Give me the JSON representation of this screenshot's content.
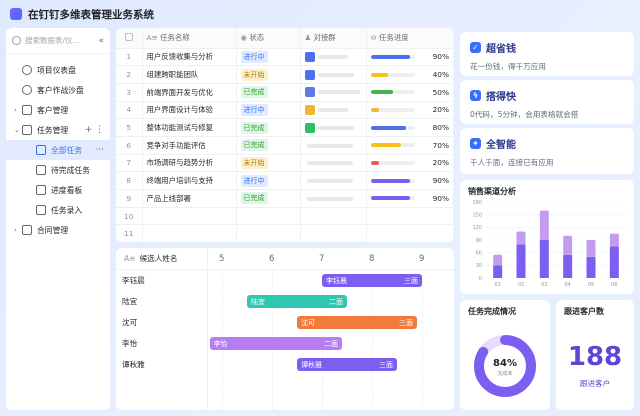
{
  "app": {
    "title": "在钉钉多维表管理业务系统"
  },
  "sidebar": {
    "search_placeholder": "搜索数据表/仪...",
    "collapse": "«",
    "items": [
      {
        "label": "项目仪表盘",
        "icon": "dashboard-icon"
      },
      {
        "label": "客户作战沙盘",
        "icon": "dashboard-icon"
      },
      {
        "label": "客户管理",
        "icon": "table-icon"
      },
      {
        "label": "任务管理",
        "icon": "table-icon"
      },
      {
        "label": "全部任务",
        "icon": "grid-icon"
      },
      {
        "label": "待完成任务",
        "icon": "list-icon"
      },
      {
        "label": "进度看板",
        "icon": "kanban-icon"
      },
      {
        "label": "任务录入",
        "icon": "form-icon"
      },
      {
        "label": "合同管理",
        "icon": "table-icon"
      }
    ]
  },
  "table": {
    "headers": {
      "name": "任务名称",
      "status": "状态",
      "group": "对接群",
      "progress": "任务进度"
    },
    "rows": [
      {
        "no": "1",
        "name": "用户反馈收集与分析",
        "status": "进行中",
        "status_type": "doing",
        "group_color": "#4e6ef2",
        "progress": 90,
        "bar_color": "#4e6ef2"
      },
      {
        "no": "2",
        "name": "组建跨职能团队",
        "status": "未开始",
        "status_type": "todo",
        "group_color": "#4e6ef2",
        "progress": 40,
        "bar_color": "#f5c318"
      },
      {
        "no": "3",
        "name": "前端界面开发与优化",
        "status": "已完成",
        "status_type": "done",
        "group_color": "#5e7ce0",
        "progress": 50,
        "bar_color": "#44b549"
      },
      {
        "no": "4",
        "name": "用户界面设计与体验",
        "status": "进行中",
        "status_type": "doing",
        "group_color": "#f2b530",
        "progress": 20,
        "bar_color": "#f2b530"
      },
      {
        "no": "5",
        "name": "整体功能测试与修复",
        "status": "已完成",
        "status_type": "done",
        "group_color": "#2ebd64",
        "progress": 80,
        "bar_color": "#4e6ef2"
      },
      {
        "no": "6",
        "name": "竞争对手功能评估",
        "status": "已完成",
        "status_type": "done",
        "group_color": "",
        "progress": 70,
        "bar_color": "#f5c318"
      },
      {
        "no": "7",
        "name": "市场调研与趋势分析",
        "status": "未开始",
        "status_type": "todo",
        "group_color": "",
        "progress": 20,
        "bar_color": "#f25757"
      },
      {
        "no": "8",
        "name": "终端用户培训与支持",
        "status": "进行中",
        "status_type": "doing",
        "group_color": "",
        "progress": 90,
        "bar_color": "#7c5ff0"
      },
      {
        "no": "9",
        "name": "产品上线部署",
        "status": "已完成",
        "status_type": "done",
        "group_color": "",
        "progress": 90,
        "bar_color": "#7c5ff0"
      },
      {
        "no": "10",
        "name": "",
        "status": "",
        "status_type": "",
        "group_color": "",
        "progress": null,
        "bar_color": ""
      },
      {
        "no": "11",
        "name": "",
        "status": "",
        "status_type": "",
        "group_color": "",
        "progress": null,
        "bar_color": ""
      }
    ]
  },
  "gantt": {
    "title": "候选人姓名",
    "ticks": [
      "5",
      "6",
      "7",
      "8",
      "9"
    ],
    "rows": [
      {
        "name": "李钰晨",
        "bar_label": "李钰晨",
        "bar_tag": "三面",
        "start": 7.0,
        "end": 9.0,
        "color": "#7c5ff0"
      },
      {
        "name": "陆宜",
        "bar_label": "陆宜",
        "bar_tag": "二面",
        "start": 5.5,
        "end": 7.5,
        "color": "#2ec7b0"
      },
      {
        "name": "沈可",
        "bar_label": "沈可",
        "bar_tag": "三面",
        "start": 6.5,
        "end": 8.9,
        "color": "#f27a3d"
      },
      {
        "name": "李怡",
        "bar_label": "李怡",
        "bar_tag": "二面",
        "start": 4.75,
        "end": 7.4,
        "color": "#b67cf0"
      },
      {
        "name": "谭秋雅",
        "bar_label": "谭秋雅",
        "bar_tag": "三面",
        "start": 6.5,
        "end": 8.5,
        "color": "#7c5ff0"
      }
    ]
  },
  "cards": [
    {
      "title": "超省钱",
      "subtitle": "花一份钱，得千万应用",
      "icon": "shield-icon"
    },
    {
      "title": "搭得快",
      "subtitle": "0代码，5分钟，会用表格就会搭",
      "icon": "lightning-icon"
    },
    {
      "title": "全智能",
      "subtitle": "千人千面，连接已有应用",
      "icon": "sparkle-icon"
    }
  ],
  "chart_data": {
    "type": "bar",
    "title": "销售渠道分析",
    "categories": [
      "01",
      "02",
      "03",
      "04",
      "05",
      "06"
    ],
    "ylim": [
      0,
      180
    ],
    "yticks": [
      0,
      30,
      60,
      90,
      120,
      150,
      180
    ],
    "series": [
      {
        "values": [
          30,
          80,
          90,
          55,
          50,
          75
        ]
      },
      {
        "values": [
          25,
          30,
          70,
          45,
          40,
          30
        ]
      }
    ],
    "colors": [
      "#7c5ff0",
      "#c39cf2"
    ]
  },
  "donut": {
    "title": "任务完成情况",
    "percent": 84,
    "label": "84%",
    "sublabel": "完成率"
  },
  "kpi": {
    "title": "跟进客户数",
    "value": "188",
    "sublabel": "跟进客户"
  }
}
